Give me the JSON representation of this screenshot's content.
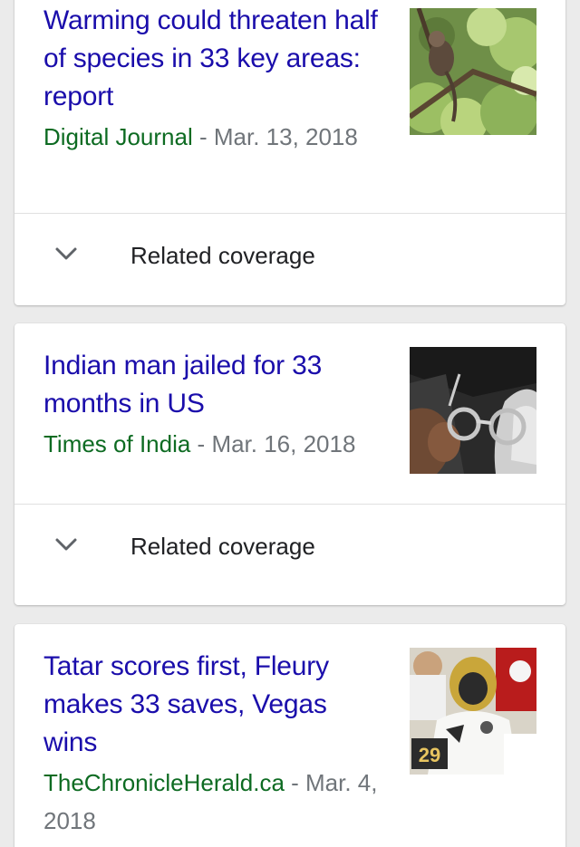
{
  "stories": [
    {
      "headline": "Warming could threaten half of species in 33 key areas: report",
      "source": "Digital Journal",
      "separator": " - ",
      "date": "Mar. 13, 2018",
      "related_label": "Related coverage",
      "thumbnail_icon": "monkey-in-tree-photo"
    },
    {
      "headline": "Indian man jailed for 33 months in US",
      "source": "Times of India",
      "separator": " - ",
      "date": "Mar. 16, 2018",
      "related_label": "Related coverage",
      "thumbnail_icon": "handcuffs-photo"
    },
    {
      "headline": "Tatar scores first, Fleury makes 33 saves, Vegas wins",
      "source": "TheChronicleHerald.ca",
      "separator": " - ",
      "date": "Mar. 4, 2018",
      "thumbnail_icon": "hockey-goalie-photo",
      "thumbnail_text": "29"
    }
  ],
  "colors": {
    "headline": "#1a0dab",
    "source": "#0d6b22",
    "meta": "#70757a",
    "background": "#ebebeb"
  },
  "icons": {
    "expand": "chevron-down-icon"
  }
}
